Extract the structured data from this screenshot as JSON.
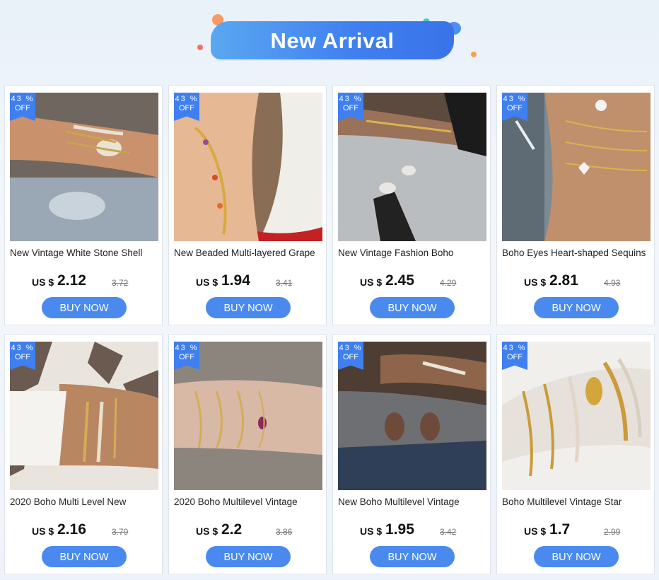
{
  "banner": {
    "title": "New Arrival"
  },
  "colors": {
    "accent": "#3f7ff0",
    "button": "#4a8aef",
    "badge": "#3f7ff0"
  },
  "products": [
    {
      "discount": "43 %",
      "discount_tail": "OFF",
      "title": "New Vintage White Stone Shell",
      "currency": "US $",
      "price": "2.12",
      "original_price": "3.72",
      "buy_label": "BUY NOW",
      "image": "bracelet-photo"
    },
    {
      "discount": "43 %",
      "discount_tail": "OFF",
      "title": "New Beaded Multi-layered Grape",
      "currency": "US $",
      "price": "1.94",
      "original_price": "3.41",
      "buy_label": "BUY NOW",
      "image": "anklet-photo"
    },
    {
      "discount": "43 %",
      "discount_tail": "OFF",
      "title": "New Vintage Fashion Boho",
      "currency": "US $",
      "price": "2.45",
      "original_price": "4.29",
      "buy_label": "BUY NOW",
      "image": "bracelet-photo"
    },
    {
      "discount": "43 %",
      "discount_tail": "OFF",
      "title": "Boho Eyes Heart-shaped Sequins",
      "currency": "US $",
      "price": "2.81",
      "original_price": "4.93",
      "buy_label": "BUY NOW",
      "image": "bracelet-photo"
    },
    {
      "discount": "43 %",
      "discount_tail": "OFF",
      "title": "2020 Boho Multi Level New",
      "currency": "US $",
      "price": "2.16",
      "original_price": "3.79",
      "buy_label": "BUY NOW",
      "image": "bracelet-photo"
    },
    {
      "discount": "43 %",
      "discount_tail": "OFF",
      "title": "2020 Boho Multilevel Vintage",
      "currency": "US $",
      "price": "2.2",
      "original_price": "3.86",
      "buy_label": "BUY NOW",
      "image": "bracelet-photo"
    },
    {
      "discount": "43 %",
      "discount_tail": "OFF",
      "title": "New Boho Multilevel Vintage",
      "currency": "US $",
      "price": "1.95",
      "original_price": "3.42",
      "buy_label": "BUY NOW",
      "image": "bracelet-photo"
    },
    {
      "discount": "43 %",
      "discount_tail": "OFF",
      "title": "Boho Multilevel Vintage Star",
      "currency": "US $",
      "price": "1.7",
      "original_price": "2.99",
      "buy_label": "BUY NOW",
      "image": "bracelet-photo"
    }
  ]
}
